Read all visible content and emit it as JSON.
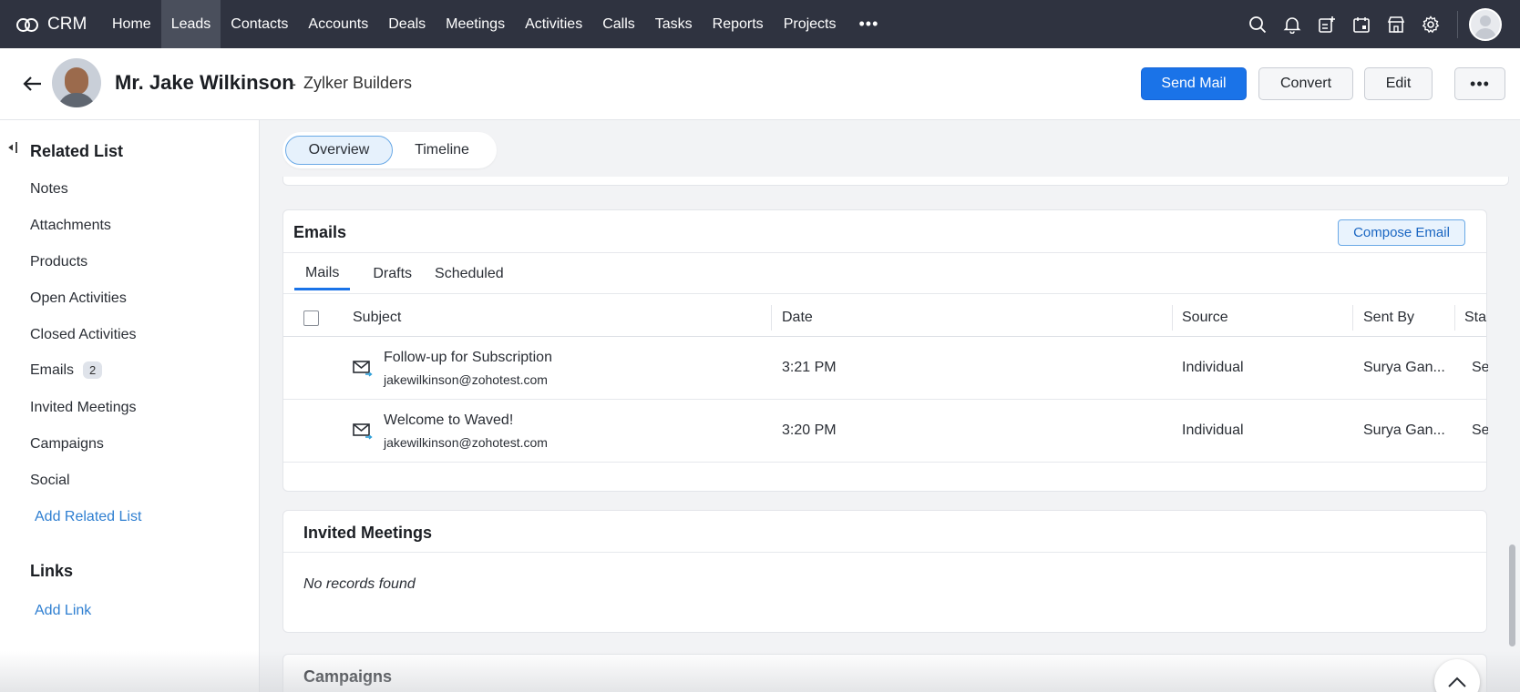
{
  "nav": {
    "brand": "CRM",
    "items": [
      "Home",
      "Leads",
      "Contacts",
      "Accounts",
      "Deals",
      "Meetings",
      "Activities",
      "Calls",
      "Tasks",
      "Reports",
      "Projects"
    ],
    "active": "Leads",
    "more": "•••",
    "right_icons": [
      "search-icon",
      "bell-icon",
      "add-note-icon",
      "calendar-icon",
      "marketplace-icon",
      "gear-icon"
    ]
  },
  "record": {
    "name": "Mr. Jake Wilkinson",
    "separator": "-",
    "company": "Zylker Builders",
    "buttons": {
      "send_mail": "Send Mail",
      "convert": "Convert",
      "edit": "Edit",
      "more": "•••"
    }
  },
  "sidebar": {
    "related_heading": "Related List",
    "items": [
      {
        "label": "Notes"
      },
      {
        "label": "Attachments"
      },
      {
        "label": "Products"
      },
      {
        "label": "Open Activities"
      },
      {
        "label": "Closed Activities"
      },
      {
        "label": "Emails",
        "badge": "2"
      },
      {
        "label": "Invited Meetings"
      },
      {
        "label": "Campaigns"
      },
      {
        "label": "Social"
      }
    ],
    "add_related": "Add Related List",
    "links_heading": "Links",
    "add_link": "Add Link"
  },
  "view_tabs": {
    "overview": "Overview",
    "timeline": "Timeline",
    "active": "Overview"
  },
  "emails": {
    "title": "Emails",
    "compose": "Compose Email",
    "tabs": [
      "Mails",
      "Drafts",
      "Scheduled"
    ],
    "active_tab": "Mails",
    "columns": {
      "subject": "Subject",
      "date": "Date",
      "source": "Source",
      "sent_by": "Sent By",
      "status": "Sta"
    },
    "rows": [
      {
        "subject": "Follow-up for Subscription",
        "email": "jakewilkinson@zohotest.com",
        "date": "3:21 PM",
        "source": "Individual",
        "sent_by": "Surya Gan...",
        "status": "Sen"
      },
      {
        "subject": "Welcome to Waved!",
        "email": "jakewilkinson@zohotest.com",
        "date": "3:20 PM",
        "source": "Individual",
        "sent_by": "Surya Gan...",
        "status": "Sen"
      }
    ]
  },
  "meetings": {
    "title": "Invited Meetings",
    "empty": "No records found"
  },
  "campaigns": {
    "title": "Campaigns"
  },
  "colors": {
    "nav_bg": "#2f3340",
    "primary": "#1a73e8",
    "link": "#2f7fd1"
  }
}
